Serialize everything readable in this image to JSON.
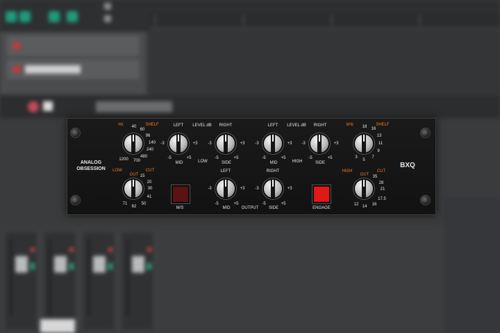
{
  "plugin": {
    "brand_line1": "ANALOG",
    "brand_line2": "OBSESSION",
    "model": "BXQ",
    "low_shelf_unit": "Hz",
    "low_shelf_label": "SHELF",
    "low_shelf_ticks": [
      "1200",
      "700",
      "480",
      "240",
      "140",
      "96",
      "60",
      "40"
    ],
    "low_cut_label1": "LOW",
    "low_cut_label2": "OUT",
    "low_cut_label3": "CUT",
    "low_cut_ticks": [
      "71",
      "62",
      "50",
      "41",
      "30",
      "20",
      "15"
    ],
    "left_label": "LEFT",
    "right_label": "RIGHT",
    "level_label": "LEVEL dB",
    "level_label2": "LEVEL dB",
    "low_label": "LOW",
    "high_label": "HIGH",
    "mid_label": "MID",
    "side_label": "SIDE",
    "output_label": "OUTPUT",
    "tick_m5": "-5",
    "tick_p5": "+5",
    "tick_m3": "-3",
    "tick_p3": "+3",
    "ms_label": "M/S",
    "engage_label": "ENGAGE",
    "high_shelf_unit": "kHz",
    "high_shelf_label": "SHELF",
    "high_shelf_ticks": [
      "3",
      "5",
      "7",
      "9",
      "11",
      "13",
      "16",
      "18"
    ],
    "high_cut_label1": "HIGH",
    "high_cut_label2": "OUT",
    "high_cut_label3": "CUT",
    "high_cut_ticks": [
      "12",
      "14",
      "16",
      "17.5",
      "21",
      "28",
      "35"
    ],
    "colors": {
      "accent": "#ff7a1a",
      "engage_on": "#e01818",
      "ms_off": "#5a1212",
      "panel": "#161616"
    }
  }
}
